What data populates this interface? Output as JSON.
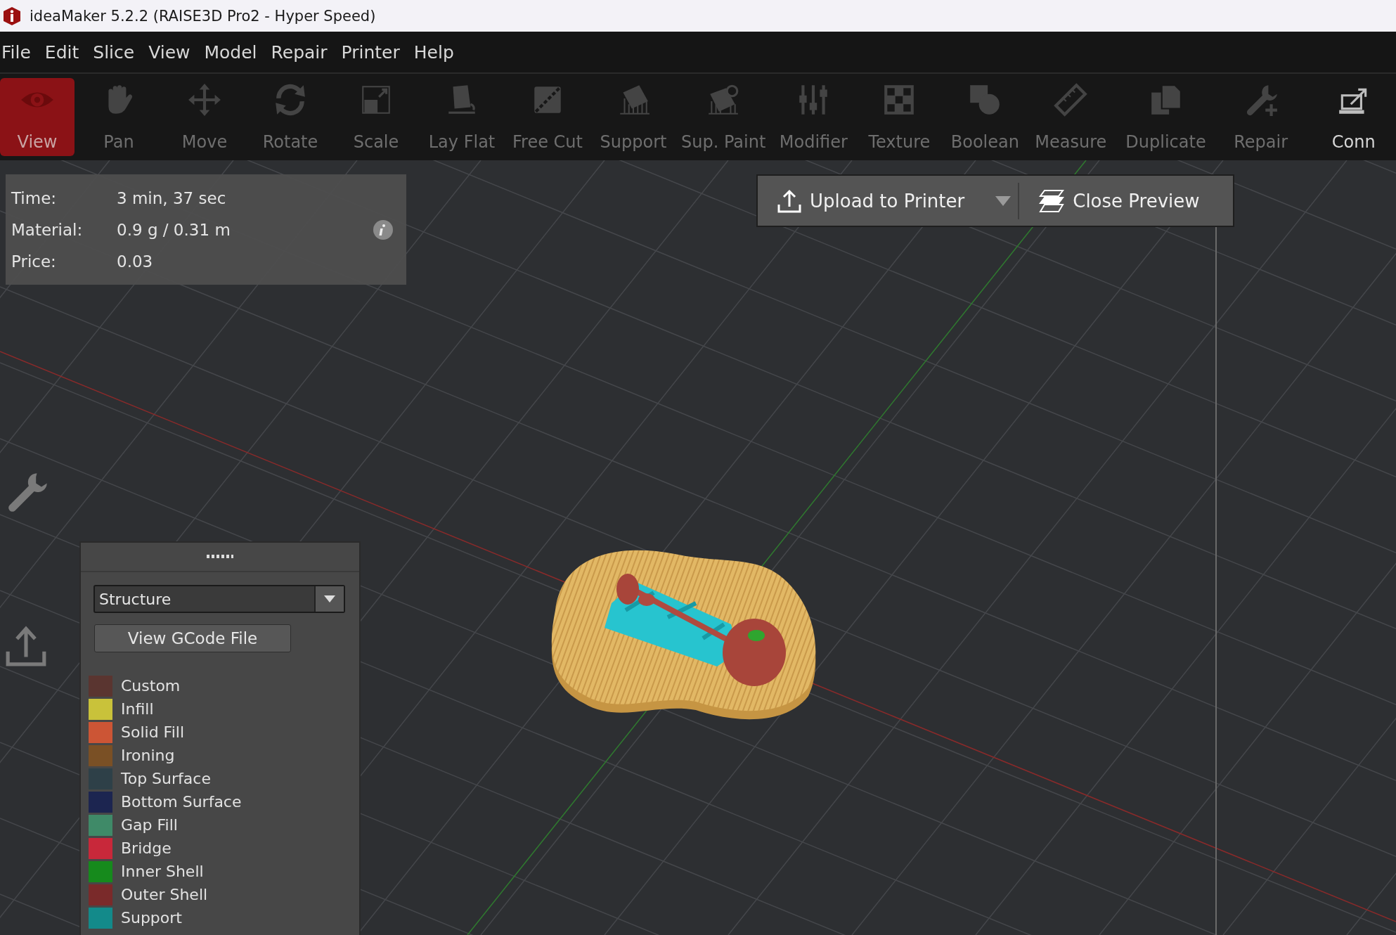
{
  "window": {
    "title": "ideaMaker 5.2.2 (RAISE3D Pro2 - Hyper Speed)"
  },
  "menu": [
    "File",
    "Edit",
    "Slice",
    "View",
    "Model",
    "Repair",
    "Printer",
    "Help"
  ],
  "toolbar": {
    "groups": [
      [
        {
          "label": "View",
          "selected": true,
          "disabled": false
        },
        {
          "label": "Pan",
          "selected": false,
          "disabled": true
        },
        {
          "label": "Move",
          "selected": false,
          "disabled": true
        },
        {
          "label": "Rotate",
          "selected": false,
          "disabled": true
        },
        {
          "label": "Scale",
          "selected": false,
          "disabled": true
        },
        {
          "label": "Lay Flat",
          "selected": false,
          "disabled": true
        },
        {
          "label": "Free Cut",
          "selected": false,
          "disabled": true
        },
        {
          "label": "Support",
          "selected": false,
          "disabled": true
        },
        {
          "label": "Sup. Paint",
          "selected": false,
          "disabled": true
        },
        {
          "label": "Modifier",
          "selected": false,
          "disabled": true
        },
        {
          "label": "Texture",
          "selected": false,
          "disabled": true
        },
        {
          "label": "Boolean",
          "selected": false,
          "disabled": true
        },
        {
          "label": "Measure",
          "selected": false,
          "disabled": true
        }
      ],
      [
        {
          "label": "Duplicate",
          "selected": false,
          "disabled": true
        }
      ],
      [
        {
          "label": "Repair",
          "selected": false,
          "disabled": true
        }
      ],
      [
        {
          "label": "Conn",
          "selected": false,
          "disabled": false
        }
      ]
    ]
  },
  "summary": [
    {
      "label": "Time:",
      "value": "3 min, 37 sec"
    },
    {
      "label": "Material:",
      "value": "0.9 g / 0.31 m"
    },
    {
      "label": "Price:",
      "value": "0.03"
    }
  ],
  "preview_actions": {
    "upload": "Upload to Printer",
    "close": "Close Preview"
  },
  "legend": {
    "view_mode": "Structure",
    "gcode_button": "View GCode File",
    "items": [
      {
        "label": "Custom",
        "color": "#5a3530"
      },
      {
        "label": "Infill",
        "color": "#c9c23a"
      },
      {
        "label": "Solid Fill",
        "color": "#cc5535"
      },
      {
        "label": "Ironing",
        "color": "#7a5025"
      },
      {
        "label": "Top Surface",
        "color": "#2e4048"
      },
      {
        "label": "Bottom Surface",
        "color": "#1c2550"
      },
      {
        "label": "Gap Fill",
        "color": "#3f8a68"
      },
      {
        "label": "Bridge",
        "color": "#c8283a"
      },
      {
        "label": "Inner Shell",
        "color": "#168a1c"
      },
      {
        "label": "Outer Shell",
        "color": "#7a2a2a"
      },
      {
        "label": "Support",
        "color": "#138a8a"
      }
    ]
  }
}
